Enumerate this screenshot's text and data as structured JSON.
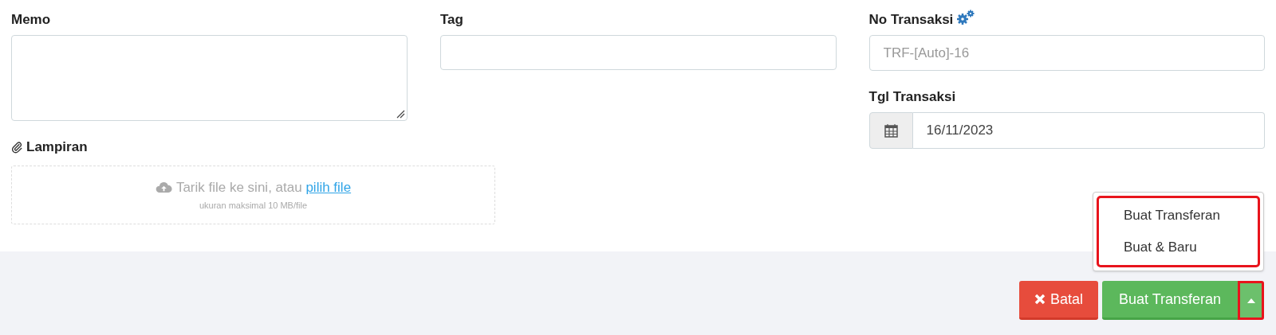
{
  "memo": {
    "label": "Memo"
  },
  "tag": {
    "label": "Tag"
  },
  "no_transaksi": {
    "label": "No Transaksi",
    "placeholder": "TRF-[Auto]-16"
  },
  "tgl_transaksi": {
    "label": "Tgl Transaksi",
    "value": "16/11/2023"
  },
  "lampiran": {
    "label": "Lampiran",
    "drop_text": "Tarik file ke sini, atau",
    "link": "pilih file",
    "hint": "ukuran maksimal 10 MB/file"
  },
  "dropdown_menu": {
    "highlighted": true,
    "items": [
      {
        "label": "Buat Transferan"
      },
      {
        "label": "Buat & Baru"
      }
    ]
  },
  "buttons": [
    {
      "kind": "cancel",
      "label": "Batal"
    },
    {
      "kind": "submit",
      "label": "Buat Transferan"
    },
    {
      "kind": "caret",
      "highlighted": true
    }
  ]
}
